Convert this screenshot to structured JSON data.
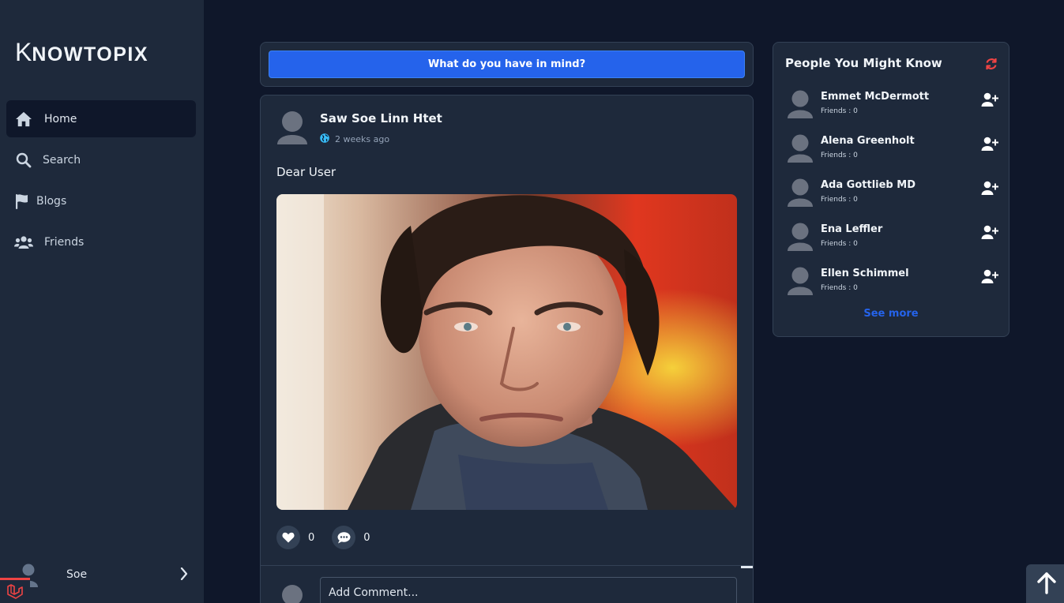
{
  "app": {
    "logo_first": "K",
    "logo_rest": "NOWTOPIX"
  },
  "sidebar": {
    "items": [
      {
        "label": "Home",
        "icon": "home-icon",
        "active": true
      },
      {
        "label": "Search",
        "icon": "search-icon",
        "active": false
      },
      {
        "label": "Blogs",
        "icon": "flag-icon",
        "active": false
      },
      {
        "label": "Friends",
        "icon": "users-icon",
        "active": false
      }
    ],
    "user": {
      "name": "Soe",
      "icon": "chevron-right-icon"
    }
  },
  "compose": {
    "label": "What do you have in mind?"
  },
  "post": {
    "author": "Saw Soe Linn Htet",
    "time": "2 weeks ago",
    "text": "Dear User",
    "likes": "0",
    "comments": "0",
    "comment_placeholder": "Add Comment..."
  },
  "people": {
    "title": "People You Might Know",
    "list": [
      {
        "name": "Emmet McDermott",
        "meta": "Friends : 0"
      },
      {
        "name": "Alena Greenholt",
        "meta": "Friends : 0"
      },
      {
        "name": "Ada Gottlieb MD",
        "meta": "Friends : 0"
      },
      {
        "name": "Ena Leffler",
        "meta": "Friends : 0"
      },
      {
        "name": "Ellen Schimmel",
        "meta": "Friends : 0"
      }
    ],
    "see_more": "See more"
  },
  "colors": {
    "background": "#0f172a",
    "panel": "#1e293b",
    "accent": "#2563eb",
    "refresh": "#ef4444"
  }
}
